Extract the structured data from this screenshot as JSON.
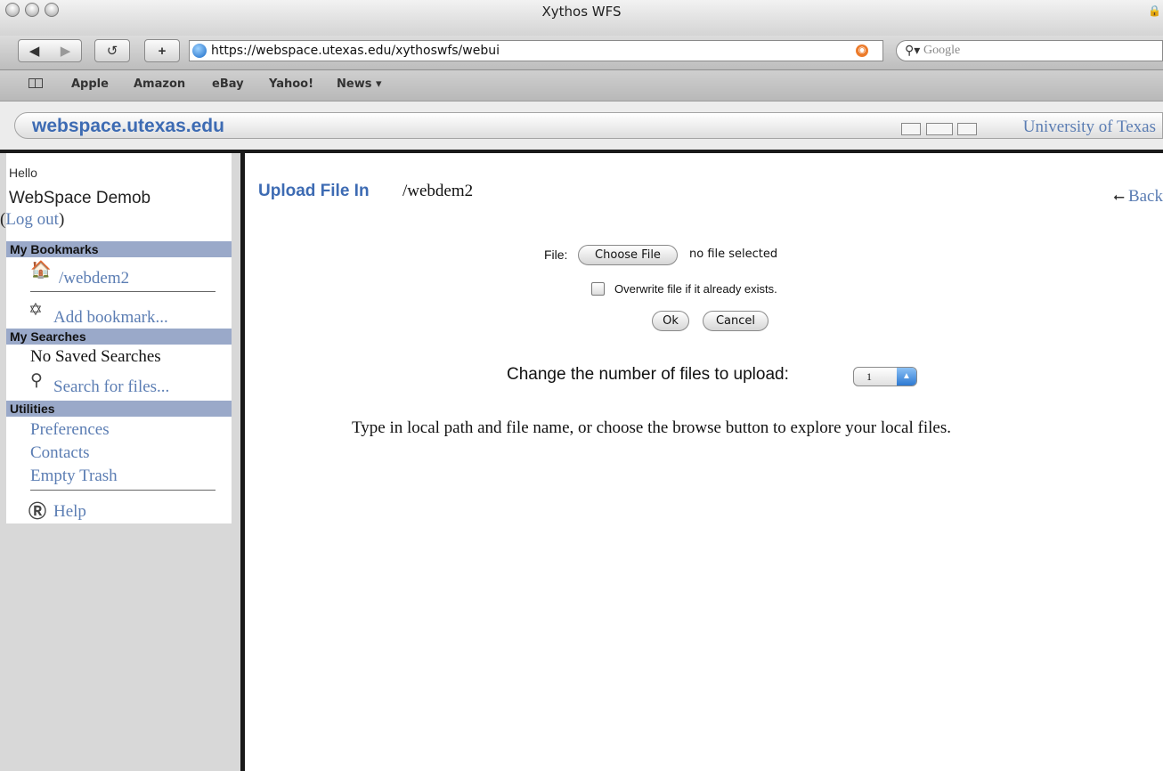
{
  "window": {
    "title": "Xythos WFS"
  },
  "toolbar": {
    "url": "https://webspace.utexas.edu/xythoswfs/webui",
    "search_placeholder": "Google"
  },
  "bookmarks_bar": [
    "Apple",
    "Amazon",
    "eBay",
    "Yahoo!",
    "News ▾"
  ],
  "site": {
    "title": "webspace.utexas.edu",
    "org_link": "University of Texas"
  },
  "sidebar": {
    "greeting": "Hello",
    "user_name": "WebSpace Demob",
    "logout_open": "(",
    "logout": "Log out",
    "logout_close": ")",
    "bookmarks_header": "My Bookmarks",
    "bookmark_item": "/webdem2",
    "add_bookmark": "Add bookmark...",
    "searches_header": "My Searches",
    "no_searches": "No Saved Searches",
    "search_files": "Search for files...",
    "utilities_header": "Utilities",
    "utilities": [
      "Preferences",
      "Contacts",
      "Empty Trash"
    ],
    "help": "Help"
  },
  "main": {
    "title": "Upload File In",
    "path": "/webdem2",
    "back": "Back",
    "file_label": "File:",
    "choose_file": "Choose File",
    "no_file": "no file selected",
    "overwrite_label": "Overwrite file if it already exists.",
    "overwrite_checked": false,
    "ok": "Ok",
    "cancel": "Cancel",
    "change_label": "Change the number of files to upload:",
    "num_files": "1",
    "instructions": "Type in local path and file name, or choose the browse button to explore your local files."
  },
  "colors": {
    "accent": "#3d6bb3",
    "link": "#5b7db3",
    "section_header": "#9aa9c9"
  },
  "icons": [
    "close-window-icon",
    "minimize-window-icon",
    "zoom-window-icon",
    "lock-icon",
    "back-arrow-icon",
    "forward-arrow-icon",
    "reload-icon",
    "add-icon",
    "globe-icon",
    "rss-icon",
    "magnifier-icon",
    "book-icon",
    "folder-icon",
    "house-icon",
    "bookmark-add-icon",
    "search-icon",
    "help-icon",
    "back-icon"
  ]
}
